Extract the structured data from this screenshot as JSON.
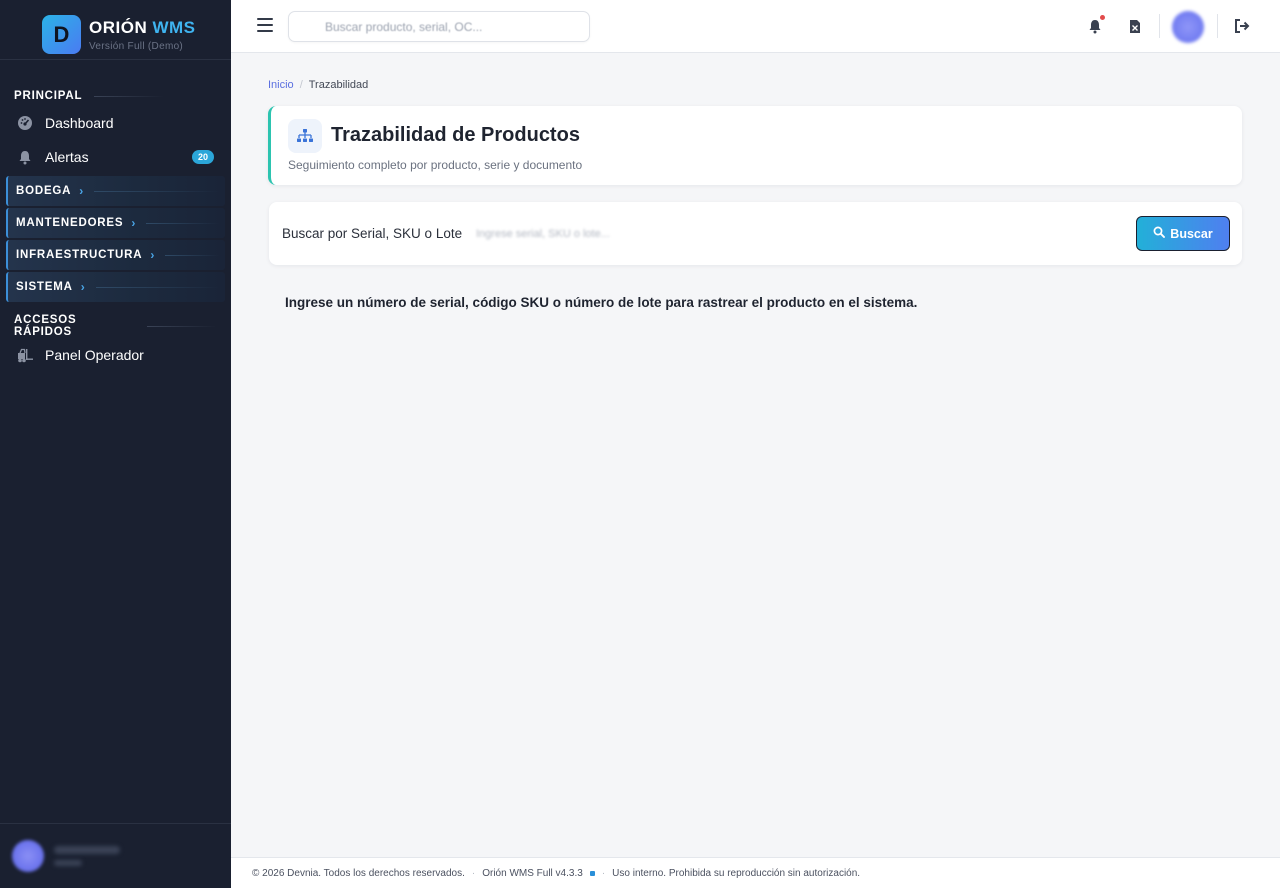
{
  "brand": {
    "name_main": "ORIÓN",
    "name_accent": "WMS",
    "logo_letter": "D",
    "version": "Versión Full (Demo)"
  },
  "sidebar": {
    "section_principal": "PRINCIPAL",
    "items": [
      {
        "label": "Dashboard",
        "icon": "gauge-icon"
      },
      {
        "label": "Alertas",
        "icon": "bell-icon",
        "badge": "20"
      }
    ],
    "groups": [
      {
        "label": "BODEGA"
      },
      {
        "label": "MANTENEDORES"
      },
      {
        "label": "INFRAESTRUCTURA"
      },
      {
        "label": "SISTEMA"
      }
    ],
    "section_quick": "ACCESOS RÁPIDOS",
    "quick_items": [
      {
        "label": "Panel Operador",
        "icon": "forklift-icon"
      }
    ]
  },
  "topbar": {
    "search_placeholder": "Buscar producto, serial, OC..."
  },
  "breadcrumb": {
    "home": "Inicio",
    "sep": "/",
    "current": "Trazabilidad"
  },
  "header": {
    "title": "Trazabilidad de Productos",
    "subtitle": "Seguimiento completo por producto, serie y documento"
  },
  "search": {
    "label": "Buscar por Serial, SKU o Lote",
    "placeholder": "Ingrese serial, SKU o lote...",
    "button_label": "Buscar"
  },
  "help_text": "Ingrese un número de serial, código SKU o número de lote para rastrear el producto en el sistema.",
  "footer": {
    "copyright": "© 2026 Devnia. Todos los derechos reservados.",
    "version": "Orión WMS Full v4.3.3",
    "notice": "Uso interno. Prohibida su reproducción sin autorización.",
    "sep": "·"
  },
  "colors": {
    "sidebar_bg": "#1a2030",
    "accent_cyan": "#2bb3e6",
    "accent_blue": "#4f7ff0",
    "accent_teal": "#2cc4b0",
    "badge": "#2ba6d9"
  }
}
